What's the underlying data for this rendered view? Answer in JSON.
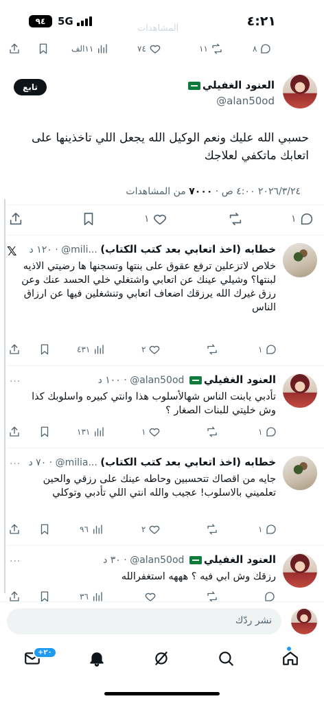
{
  "status_bar": {
    "battery": "٩٤",
    "network": "5G",
    "time": "٤:٢١",
    "ghost_text": "المشاهدات"
  },
  "top_actions": {
    "views": "١١الف",
    "likes": "٧٤",
    "retweets": "١١",
    "replies": "٨"
  },
  "author": {
    "name": "العنود الغفيلي",
    "handle": "@alan50od",
    "follow_label": "تابع"
  },
  "main_tweet": {
    "text": "حسبي الله عليك ونعم الوكيل الله يجعل اللي تاخذينها على اتعابك ماتكفي لعلاجك",
    "meta": "٢٠٢٦/٣/٢٤ ٤:٠٠ ص · ",
    "views_count": "٧٠٠٠",
    "views_label": " من المشاهدات",
    "likes": "١",
    "replies": "١"
  },
  "replies": [
    {
      "name": "خطابه (اخذ اتعابي بعد كتب الكتاب)",
      "handle": "@mili...",
      "time": "١٢٠ د",
      "text": "خلاص لاتزعلين ترفع عقوق على بنتها وتسجنها ها رضيتي الاذيه لبنتها؟ وشيلي عينك عن اتعابي واشتغلي خلي الحسد عنك وعن رزق غيرك الله يرزقك اضعاف اتعابي وتنشغلين فيها عن ارزاق الناس",
      "views": "٤٣١",
      "likes": "٢",
      "replies": "١",
      "retweets": ""
    },
    {
      "name": "العنود الغفيلي",
      "handle": "@alan50od",
      "time": "١٠٠ د",
      "text": "تأدبي يابنت الناس شهالأسلوب هذا وانتي كبيره واسلوبك كذا وش خليتي للبنات الصغار ؟",
      "views": "١٣١",
      "likes": "١",
      "replies": "١",
      "retweets": ""
    },
    {
      "name": "خطابه (اخذ اتعابي بعد كتب الكتاب)",
      "handle": "@milia...",
      "time": "٧٠ د",
      "text": "جايه من اقصاك تتحسبين وحاطه عينك على رزقي والحين تعلميني بالاسلوب! عجيب والله انتي اللي تأدبي وتوكلي",
      "views": "٩٦",
      "likes": "٢",
      "replies": "١",
      "retweets": ""
    },
    {
      "name": "العنود الغفيلي",
      "handle": "@alan50od",
      "time": "٣٠ د",
      "text": "رزقك وش ابي فيه ؟ هههه استغفرالله",
      "views": "٣٦",
      "likes": "",
      "replies": "",
      "retweets": ""
    }
  ],
  "compose": {
    "placeholder": "نشر ردّك"
  },
  "tabbar": {
    "messages_badge": "+٢٠"
  },
  "colors": {
    "accent": "#1d9bf0",
    "muted": "#536471",
    "text": "#0f1419"
  }
}
